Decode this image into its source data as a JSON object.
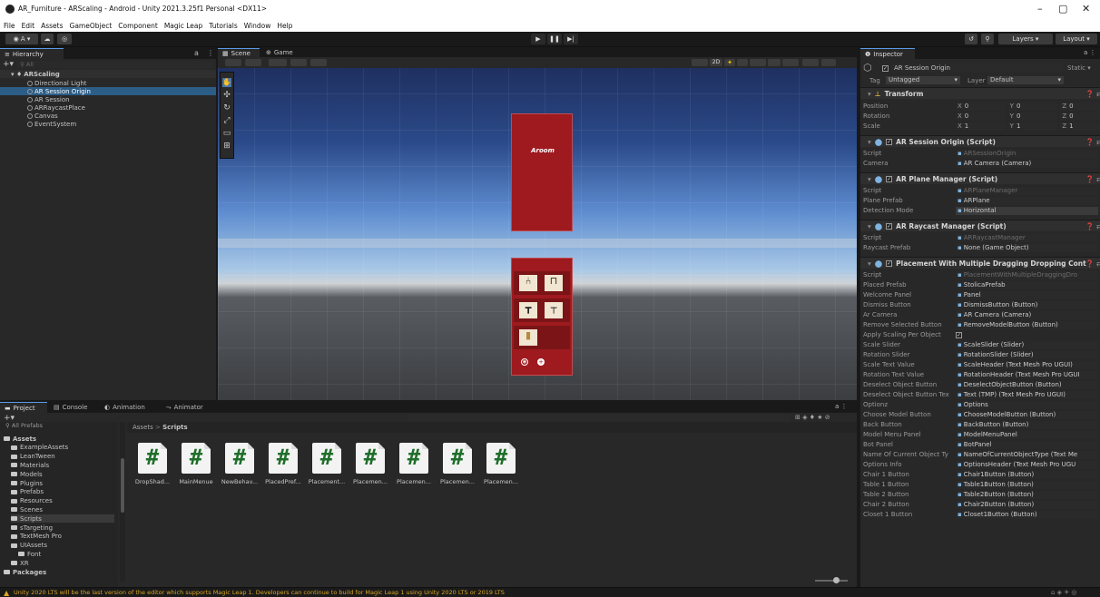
{
  "window": {
    "title": "AR_Furniture - ARScaling - Android - Unity 2021.3.25f1 Personal <DX11>",
    "controls": [
      "–",
      "▢",
      "✕"
    ]
  },
  "menu": [
    "File",
    "Edit",
    "Assets",
    "GameObject",
    "Component",
    "Magic Leap",
    "Tutorials",
    "Window",
    "Help"
  ],
  "toolbar": {
    "layers_label": "Layers",
    "layout_label": "Layout"
  },
  "hierarchy": {
    "tab": "Hierarchy",
    "search_placeholder": "All",
    "scene": "ARScaling",
    "items": [
      {
        "label": "Directional Light",
        "indent": 1,
        "selected": false
      },
      {
        "label": "AR Session Origin",
        "indent": 1,
        "selected": true
      },
      {
        "label": "AR Session",
        "indent": 1,
        "selected": false
      },
      {
        "label": "ARRaycastPlace",
        "indent": 1,
        "selected": false
      },
      {
        "label": "Canvas",
        "indent": 1,
        "selected": false
      },
      {
        "label": "EventSystem",
        "indent": 1,
        "selected": false
      }
    ]
  },
  "scene_view": {
    "tabs": [
      "Scene",
      "Game"
    ],
    "mode_2d": "2D",
    "panel_text": "Aroom"
  },
  "project": {
    "tabs": [
      "Project",
      "Console",
      "Animation",
      "Animator"
    ],
    "search_label": "All Prefabs",
    "breadcrumb": [
      "Assets",
      "Scripts"
    ],
    "tree": [
      {
        "label": "Assets",
        "depth": 0
      },
      {
        "label": "ExampleAssets",
        "depth": 1
      },
      {
        "label": "LeanTween",
        "depth": 1
      },
      {
        "label": "Materials",
        "depth": 1
      },
      {
        "label": "Models",
        "depth": 1
      },
      {
        "label": "Plugins",
        "depth": 1
      },
      {
        "label": "Prefabs",
        "depth": 1
      },
      {
        "label": "Resources",
        "depth": 1
      },
      {
        "label": "Scenes",
        "depth": 1
      },
      {
        "label": "Scripts",
        "depth": 1
      },
      {
        "label": "sTargeting",
        "depth": 1
      },
      {
        "label": "TextMesh Pro",
        "depth": 1
      },
      {
        "label": "UIAssets",
        "depth": 1
      },
      {
        "label": "Font",
        "depth": 2
      },
      {
        "label": "XR",
        "depth": 1
      },
      {
        "label": "Packages",
        "depth": 0
      }
    ],
    "scripts": [
      "DropShad...",
      "MainMenue",
      "NewBehav...",
      "PlacedPref...",
      "Placement...",
      "Placemen...",
      "Placemen...",
      "Placemen...",
      "Placemen..."
    ],
    "hash": "#"
  },
  "inspector": {
    "tab": "Inspector",
    "object_name": "AR Session Origin",
    "static_label": "Static",
    "tag_label": "Tag",
    "tag_value": "Untagged",
    "layer_label": "Layer",
    "layer_value": "Default",
    "transform": {
      "title": "Transform",
      "rows": [
        {
          "label": "Position",
          "x": "0",
          "y": "0",
          "z": "0"
        },
        {
          "label": "Rotation",
          "x": "0",
          "y": "0",
          "z": "0"
        },
        {
          "label": "Scale",
          "x": "1",
          "y": "1",
          "z": "1"
        }
      ]
    },
    "components": [
      {
        "title": "AR Session Origin (Script)",
        "rows": [
          {
            "label": "Script",
            "value": "ARSessionOrigin",
            "disabled": true
          },
          {
            "label": "Camera",
            "value": "AR Camera (Camera)",
            "disabled": false
          }
        ]
      },
      {
        "title": "AR Plane Manager (Script)",
        "rows": [
          {
            "label": "Script",
            "value": "ARPlaneManager",
            "disabled": true
          },
          {
            "label": "Plane Prefab",
            "value": "ARPlane",
            "disabled": false
          },
          {
            "label": "Detection Mode",
            "value": "Horizontal",
            "disabled": false
          }
        ]
      },
      {
        "title": "AR Raycast Manager (Script)",
        "rows": [
          {
            "label": "Script",
            "value": "ARRaycastManager",
            "disabled": true
          },
          {
            "label": "Raycast Prefab",
            "value": "None (Game Object)",
            "disabled": false
          }
        ]
      },
      {
        "title": "Placement With Multiple Dragging Dropping Cont",
        "rows": [
          {
            "label": "Script",
            "value": "PlacementWithMultipleDraggingDro",
            "disabled": true
          },
          {
            "label": "Placed Prefab",
            "value": "StolicaPrefab",
            "disabled": false
          },
          {
            "label": "Welcome Panel",
            "value": "Panel",
            "disabled": false
          },
          {
            "label": "Dismiss Button",
            "value": "DismissButton (Button)",
            "disabled": false
          },
          {
            "label": "Ar Camera",
            "value": "AR Camera (Camera)",
            "disabled": false
          },
          {
            "label": "Remove Selected Button",
            "value": "RemoveModelButton (Button)",
            "disabled": false
          },
          {
            "label": "Apply Scaling Per Object",
            "value": "✓",
            "disabled": false
          },
          {
            "label": "Scale Slider",
            "value": "ScaleSlider (Slider)",
            "disabled": false
          },
          {
            "label": "Rotation Slider",
            "value": "RotationSlider (Slider)",
            "disabled": false
          },
          {
            "label": "Scale Text Value",
            "value": "ScaleHeader (Text Mesh Pro UGUI)",
            "disabled": false
          },
          {
            "label": "Rotation Text Value",
            "value": "RotationHeader (Text Mesh Pro UGUI",
            "disabled": false
          },
          {
            "label": "Deselect Object Button",
            "value": "DeselectObjectButton (Button)",
            "disabled": false
          },
          {
            "label": "Deselect Object Button Tex",
            "value": "Text (TMP) (Text Mesh Pro UGUI)",
            "disabled": false
          },
          {
            "label": "Optionz",
            "value": "Options",
            "disabled": false
          },
          {
            "label": "Choose Model Button",
            "value": "ChooseModelButton (Button)",
            "disabled": false
          },
          {
            "label": "Back Button",
            "value": "BackButton (Button)",
            "disabled": false
          },
          {
            "label": "Model Menu Panel",
            "value": "ModelMenuPanel",
            "disabled": false
          },
          {
            "label": "Bot Panel",
            "value": "BotPanel",
            "disabled": false
          },
          {
            "label": "Name Of Current Object Ty",
            "value": "NameOfCurrentObjectType (Text Me",
            "disabled": false
          },
          {
            "label": "Options Info",
            "value": "OptionsHeader (Text Mesh Pro UGU",
            "disabled": false
          },
          {
            "label": "Chair 1 Button",
            "value": "Chair1Button (Button)",
            "disabled": false
          },
          {
            "label": "Table 1 Button",
            "value": "Table1Button (Button)",
            "disabled": false
          },
          {
            "label": "Table 2 Button",
            "value": "Table2Button (Button)",
            "disabled": false
          },
          {
            "label": "Chair 2 Button",
            "value": "Chair2Button (Button)",
            "disabled": false
          },
          {
            "label": "Closet 1 Button",
            "value": "Closet1Button (Button)",
            "disabled": false
          }
        ]
      }
    ]
  },
  "statusbar": {
    "message": "Unity 2020 LTS will be the last version of the editor which supports Magic Leap 1. Developers can continue to build for Magic Leap 1 using Unity 2020 LTS or 2019 LTS"
  },
  "colors": {
    "selection": "#2c5d87",
    "warning": "#d8a623",
    "script_icon": "#1f6e2a",
    "panel_red": "#9e1a1f"
  }
}
